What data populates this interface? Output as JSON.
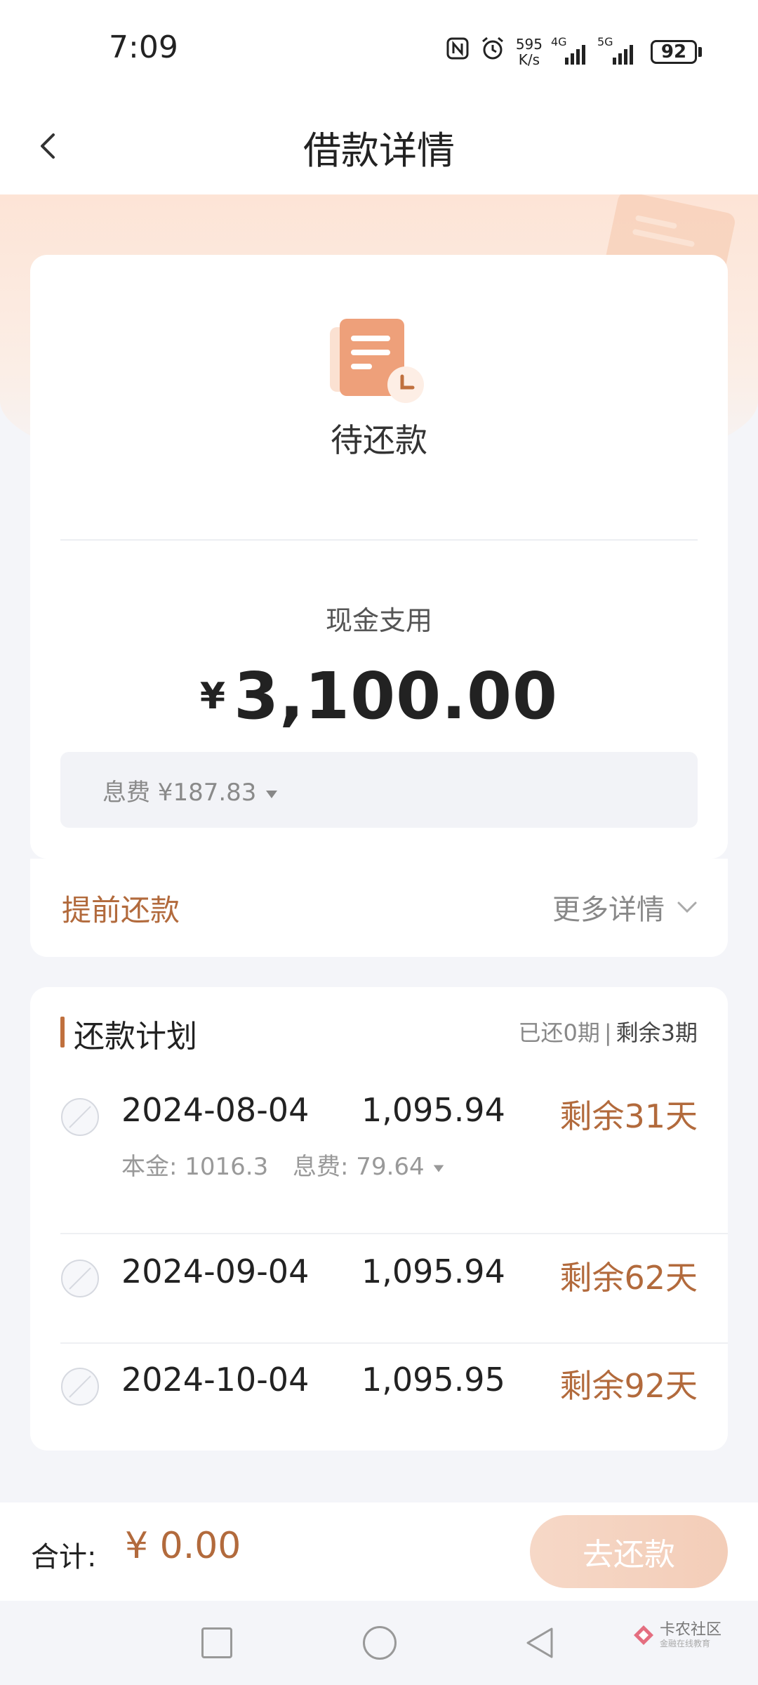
{
  "status_bar": {
    "time": "7:09",
    "net_speed_value": "595",
    "net_speed_unit": "K/s",
    "signal1_label": "4G",
    "signal2_label": "5G",
    "battery": "92"
  },
  "header": {
    "title": "借款详情"
  },
  "summary": {
    "status": "待还款",
    "purpose": "现金支用",
    "currency": "¥",
    "amount": "3,100.00",
    "fee": "息费 ¥187.83"
  },
  "actions": {
    "prepay": "提前还款",
    "more_details": "更多详情"
  },
  "plan": {
    "title": "还款计划",
    "paid": "已还0期",
    "separator": "|",
    "remaining": "剩余3期",
    "rows": [
      {
        "date": "2024-08-04",
        "amount": "1,095.94",
        "days_left": "剩余31天",
        "principal": "本金: 1016.3",
        "interest": "息费: 79.64"
      },
      {
        "date": "2024-09-04",
        "amount": "1,095.94",
        "days_left": "剩余62天"
      },
      {
        "date": "2024-10-04",
        "amount": "1,095.95",
        "days_left": "剩余92天"
      }
    ]
  },
  "footer": {
    "total_label": "合计:",
    "total_value": "¥ 0.00",
    "pay_button": "去还款"
  },
  "watermark": {
    "name": "卡农社区",
    "tagline": "金融在线教育"
  },
  "colors": {
    "accent": "#b26a3c",
    "button": "#f3cdb8",
    "background": "#f4f5f9"
  }
}
